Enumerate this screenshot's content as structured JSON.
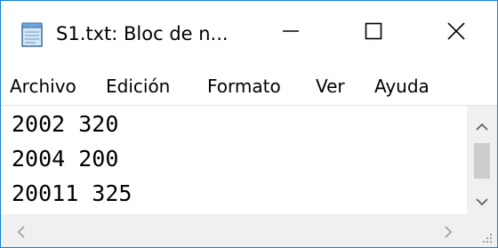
{
  "window": {
    "title": "S1.txt: Bloc de n...",
    "app_icon": "notepad-icon",
    "controls": {
      "minimize_icon": "minimize-icon",
      "maximize_icon": "maximize-icon",
      "close_icon": "close-icon"
    }
  },
  "menu": {
    "items": [
      {
        "label": "Archivo"
      },
      {
        "label": "Edición"
      },
      {
        "label": "Formato"
      },
      {
        "label": "Ver"
      },
      {
        "label": "Ayuda"
      }
    ]
  },
  "editor": {
    "lines": [
      "2002 320",
      "2004 200",
      "20011 325"
    ]
  },
  "colors": {
    "window_border": "#1883d7",
    "scrollbar_bg": "#f0f0f0",
    "scroll_thumb": "#cdcdcd"
  }
}
